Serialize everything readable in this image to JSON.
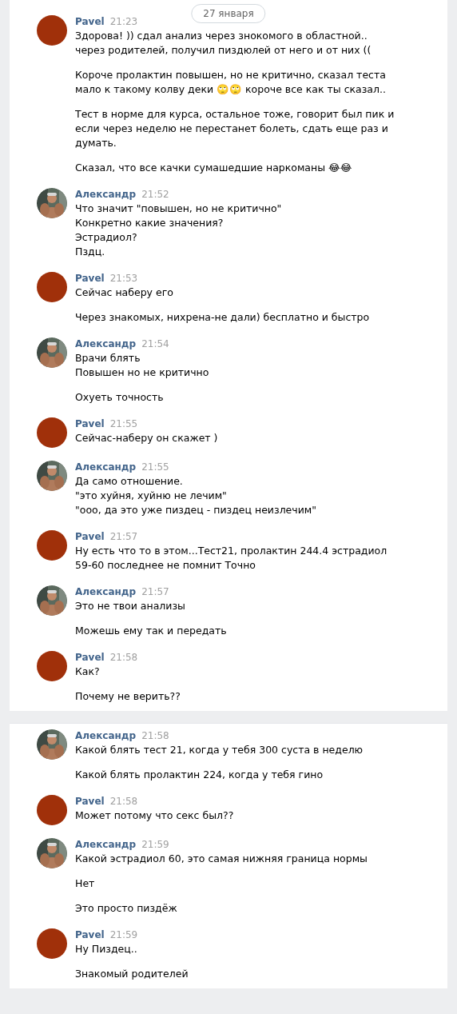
{
  "date_label": "27 января",
  "sections": [
    {
      "messages": [
        {
          "author": "Pavel",
          "time": "21:23",
          "avatar": {
            "kind": "plain"
          },
          "paragraphs": [
            [
              "Здорова! )) сдал анализ через знокомого в областной.. через родителей, получил пиздюлей от него и от них (("
            ],
            [
              "Короче пролактин повышен, но не критично, сказал теста мало к такому колву деки 🙄🙄 короче все как ты сказал.."
            ],
            [
              "Тест в норме для курса, остальное тоже, говорит был пик и если через неделю не перестанет болеть, сдать еще раз и думать."
            ],
            [
              "Сказал, что все качки сумашедшие наркоманы 😂😂"
            ]
          ]
        },
        {
          "author": "Александр",
          "time": "21:52",
          "avatar": {
            "kind": "picture"
          },
          "paragraphs": [
            [
              "Что значит \"повышен, но не критично\"",
              "Конкретно какие значения?",
              "Эстрадиол?",
              "Пздц."
            ]
          ]
        },
        {
          "author": "Pavel",
          "time": "21:53",
          "avatar": {
            "kind": "plain"
          },
          "paragraphs": [
            [
              "Сейчас наберу его"
            ],
            [
              "Через знакомых, нихрена-не дали) бесплатно и быстро"
            ]
          ]
        },
        {
          "author": "Александр",
          "time": "21:54",
          "avatar": {
            "kind": "picture"
          },
          "paragraphs": [
            [
              "Врачи блять",
              "Повышен но не критично"
            ],
            [
              "Охуеть точность"
            ]
          ]
        },
        {
          "author": "Pavel",
          "time": "21:55",
          "avatar": {
            "kind": "plain"
          },
          "paragraphs": [
            [
              "Сейчас-наберу он скажет )"
            ]
          ]
        },
        {
          "author": "Александр",
          "time": "21:55",
          "avatar": {
            "kind": "picture"
          },
          "paragraphs": [
            [
              "Да само отношение.",
              "\"это хуйня, хуйню не лечим\"",
              "\"ооо, да это уже пиздец - пиздец неизлечим\""
            ]
          ]
        },
        {
          "author": "Pavel",
          "time": "21:57",
          "avatar": {
            "kind": "plain"
          },
          "paragraphs": [
            [
              "Ну есть что то в этом...Тест21, пролактин 244.4 эстрадиол 59-60 последнее не помнит Точно"
            ]
          ]
        },
        {
          "author": "Александр",
          "time": "21:57",
          "avatar": {
            "kind": "picture"
          },
          "paragraphs": [
            [
              "Это не твои анализы"
            ],
            [
              "Можешь ему так и передать"
            ]
          ]
        },
        {
          "author": "Pavel",
          "time": "21:58",
          "avatar": {
            "kind": "plain"
          },
          "paragraphs": [
            [
              "Как?"
            ],
            [
              "Почему не верить??"
            ]
          ]
        }
      ]
    },
    {
      "messages": [
        {
          "author": "Александр",
          "time": "21:58",
          "avatar": {
            "kind": "picture"
          },
          "paragraphs": [
            [
              "Какой блять тест 21, когда у тебя 300 суста в неделю"
            ],
            [
              "Какой блять пролактин 224, когда у тебя гино"
            ]
          ]
        },
        {
          "author": "Pavel",
          "time": "21:58",
          "avatar": {
            "kind": "plain"
          },
          "paragraphs": [
            [
              "Может потому что секс был??"
            ]
          ]
        },
        {
          "author": "Александр",
          "time": "21:59",
          "avatar": {
            "kind": "picture"
          },
          "paragraphs": [
            [
              "Какой эстрадиол 60, это самая нижняя граница нормы"
            ],
            [
              "Нет"
            ],
            [
              "Это просто пиздёж"
            ]
          ]
        },
        {
          "author": "Pavel",
          "time": "21:59",
          "avatar": {
            "kind": "plain"
          },
          "paragraphs": [
            [
              "Ну Пиздец.."
            ],
            [
              "Знакомый родителей"
            ]
          ]
        }
      ]
    }
  ]
}
